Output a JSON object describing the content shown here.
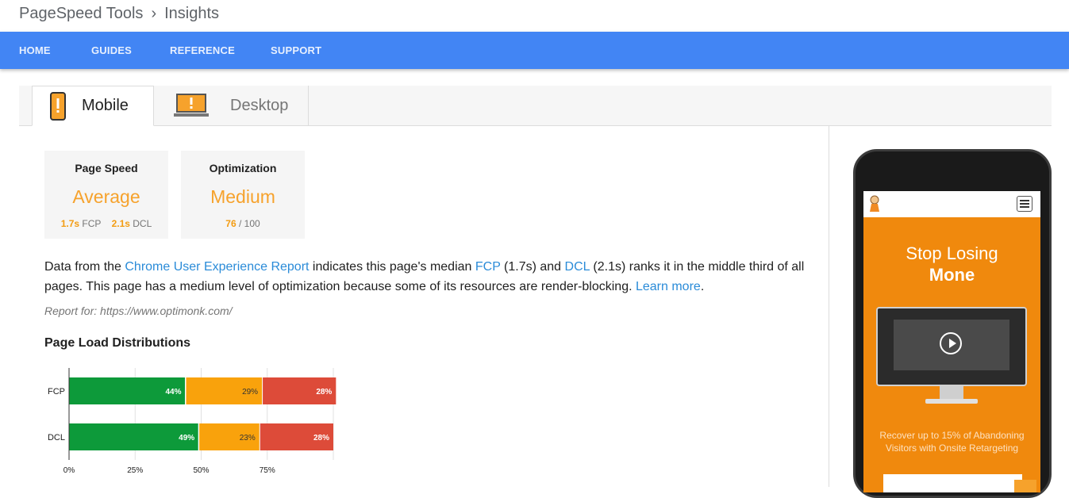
{
  "breadcrumb": {
    "root": "PageSpeed Tools",
    "separator": "›",
    "current": "Insights"
  },
  "nav": {
    "items": [
      "HOME",
      "GUIDES",
      "REFERENCE",
      "SUPPORT"
    ]
  },
  "tabs": {
    "mobile": "Mobile",
    "desktop": "Desktop"
  },
  "scores": {
    "speed": {
      "title": "Page Speed",
      "value": "Average",
      "fcp_val": "1.7s",
      "fcp_label": "FCP",
      "dcl_val": "2.1s",
      "dcl_label": "DCL"
    },
    "optimization": {
      "title": "Optimization",
      "value": "Medium",
      "score": "76",
      "total": "/ 100"
    }
  },
  "colors": {
    "nav": "#4285f4",
    "accent": "#f6a22c",
    "fast": "#0d9a3a",
    "average": "#f9a20c",
    "slow": "#dd4b39",
    "link": "#2a8bd8"
  },
  "description": {
    "p1": "Data from the ",
    "link1": "Chrome User Experience Report",
    "p2": " indicates this page's median ",
    "link2": "FCP",
    "p3": " (1.7s) and ",
    "link3": "DCL",
    "p4": " (2.1s) ranks it in the middle third of all pages. This page has a medium level of optimization because some of its resources are render-blocking. ",
    "link4": "Learn more",
    "p5": "."
  },
  "report_for": "Report for: https://www.optimonk.com/",
  "distributions_title": "Page Load Distributions",
  "chart_data": {
    "type": "bar",
    "orientation": "horizontal-stacked",
    "categories": [
      "FCP",
      "DCL"
    ],
    "series": [
      {
        "values": [
          44,
          49
        ]
      },
      {
        "values": [
          29,
          23
        ]
      },
      {
        "values": [
          28,
          28
        ]
      }
    ],
    "value_labels": [
      [
        "44%",
        "29%",
        "28%"
      ],
      [
        "49%",
        "23%",
        "28%"
      ]
    ],
    "x_ticks": [
      "0%",
      "25%",
      "50%",
      "75%"
    ],
    "xlim": [
      0,
      100
    ],
    "grid": true
  },
  "phone": {
    "headline1": "Stop Losing",
    "headline2": "Mone",
    "subtext": "Recover up to 15% of Abandoning Visitors with Onsite Retargeting"
  }
}
